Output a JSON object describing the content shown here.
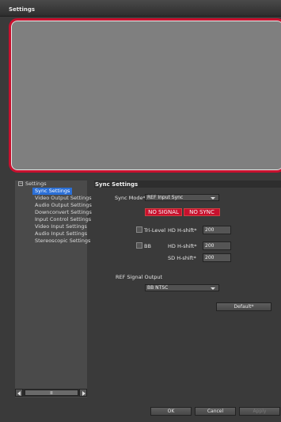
{
  "window": {
    "title": "Settings"
  },
  "tree": {
    "root_label": "Settings",
    "collapse_glyph": "−",
    "items": [
      {
        "label": "Sync Settings",
        "selected": true
      },
      {
        "label": "Video Output Settings",
        "selected": false
      },
      {
        "label": "Audio Output Settings",
        "selected": false
      },
      {
        "label": "Downconvert Settings",
        "selected": false
      },
      {
        "label": "Input Control Settings",
        "selected": false
      },
      {
        "label": "Video Input Settings",
        "selected": false
      },
      {
        "label": "Audio Input Settings",
        "selected": false
      },
      {
        "label": "Stereoscopic Settings",
        "selected": false
      }
    ],
    "scroll_grip": "Ⅲ"
  },
  "panel": {
    "header": "Sync Settings",
    "sync_mode": {
      "label": "Sync Mode*",
      "value": "REF Input Sync"
    },
    "status": {
      "no_signal": "NO SIGNAL",
      "no_sync": "NO SYNC",
      "color": "#c8102e"
    },
    "tri_level": {
      "label": "Tri-Level",
      "checked": false
    },
    "hd_hshift_1": {
      "label": "HD H-shift*",
      "value": "200"
    },
    "bb": {
      "label": "BB",
      "checked": false
    },
    "hd_hshift_2": {
      "label": "HD H-shift*",
      "value": "200"
    },
    "sd_hshift": {
      "label": "SD H-shift*",
      "value": "200"
    },
    "ref_signal_output": {
      "label": "REF Signal Output",
      "value": "BB NTSC"
    },
    "default_button": "Default*"
  },
  "footer": {
    "ok": "OK",
    "cancel": "Cancel",
    "apply": "Apply"
  }
}
